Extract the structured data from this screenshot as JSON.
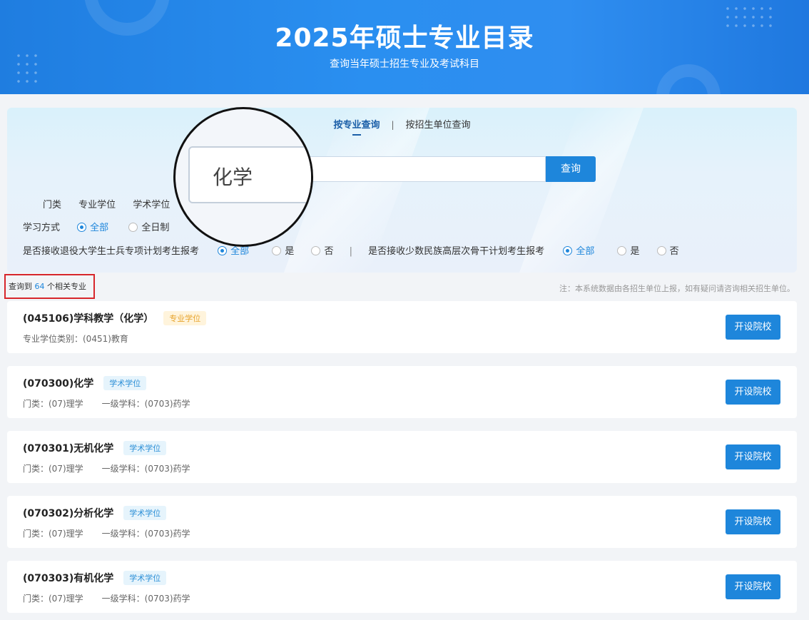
{
  "header": {
    "title": "2025年硕士专业目录",
    "subtitle": "查询当年硕士招生专业及考试科目"
  },
  "tabs": [
    {
      "label": "按专业查询",
      "active": true
    },
    {
      "label": "按招生单位查询",
      "active": false
    }
  ],
  "tab_separator": "|",
  "search": {
    "value": "化学",
    "button_label": "查询"
  },
  "filters": {
    "category": {
      "label": "门类",
      "options": [
        "专业学位",
        "学术学位"
      ]
    },
    "study_mode": {
      "label": "学习方式",
      "options": [
        {
          "label": "全部",
          "selected": true
        },
        {
          "label": "全日制",
          "selected": false
        }
      ]
    },
    "veteran_plan": {
      "label": "是否接收退役大学生士兵专项计划考生报考",
      "options": [
        {
          "label": "全部",
          "selected": true
        },
        {
          "label": "是",
          "selected": false
        },
        {
          "label": "否",
          "selected": false
        }
      ]
    },
    "minority_plan": {
      "label": "是否接收少数民族高层次骨干计划考生报考",
      "options": [
        {
          "label": "全部",
          "selected": true
        },
        {
          "label": "是",
          "selected": false
        },
        {
          "label": "否",
          "selected": false
        }
      ]
    },
    "separator": "|"
  },
  "result": {
    "prefix": "查询到",
    "count": "64",
    "suffix": "个相关专业",
    "note": "注：本系统数据由各招生单位上报，如有疑问请咨询相关招生单位。"
  },
  "majors": [
    {
      "name": "(045106)学科教学（化学）",
      "tag": "专业学位",
      "tag_type": "pro",
      "meta": [
        "专业学位类别：(0451)教育"
      ],
      "button": "开设院校"
    },
    {
      "name": "(070300)化学",
      "tag": "学术学位",
      "tag_type": "aca",
      "meta": [
        "门类：(07)理学",
        "一级学科：(0703)药学"
      ],
      "button": "开设院校"
    },
    {
      "name": "(070301)无机化学",
      "tag": "学术学位",
      "tag_type": "aca",
      "meta": [
        "门类：(07)理学",
        "一级学科：(0703)药学"
      ],
      "button": "开设院校"
    },
    {
      "name": "(070302)分析化学",
      "tag": "学术学位",
      "tag_type": "aca",
      "meta": [
        "门类：(07)理学",
        "一级学科：(0703)药学"
      ],
      "button": "开设院校"
    },
    {
      "name": "(070303)有机化学",
      "tag": "学术学位",
      "tag_type": "aca",
      "meta": [
        "门类：(07)理学",
        "一级学科：(0703)药学"
      ],
      "button": "开设院校"
    }
  ],
  "colors": {
    "brand_blue": "#1e86db",
    "highlight_red": "#d7262b",
    "pro_tag": "#e7a32c",
    "aca_tag": "#2a8ed6"
  }
}
